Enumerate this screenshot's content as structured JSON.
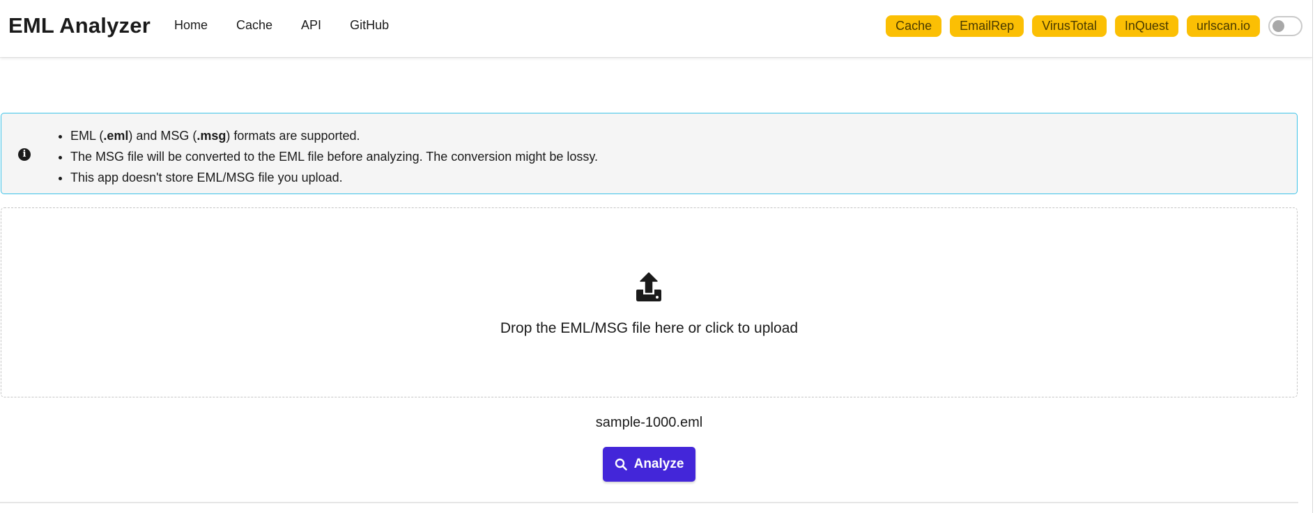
{
  "navbar": {
    "brand": "EML Analyzer",
    "links": [
      "Home",
      "Cache",
      "API",
      "GitHub"
    ],
    "tags": [
      "Cache",
      "EmailRep",
      "VirusTotal",
      "InQuest",
      "urlscan.io"
    ],
    "theme_toggle_on": false,
    "tag_color": "#fbbf04"
  },
  "notice": {
    "icon": "info-circle-icon",
    "items": [
      {
        "pre": "EML (",
        "b1": ".eml",
        "mid": ") and MSG (",
        "b2": ".msg",
        "post": ") formats are supported."
      },
      {
        "text": "The MSG file will be converted to the EML file before analyzing. The conversion might be lossy."
      },
      {
        "text": "This app doesn't store EML/MSG file you upload."
      }
    ],
    "border_color": "#3ec3e8"
  },
  "dropzone": {
    "icon": "upload-icon",
    "text": "Drop the EML/MSG file here or click to upload"
  },
  "selected_file": "sample-1000.eml",
  "analyze_button": {
    "label": "Analyze",
    "icon": "search-icon",
    "color": "#4326d9"
  }
}
